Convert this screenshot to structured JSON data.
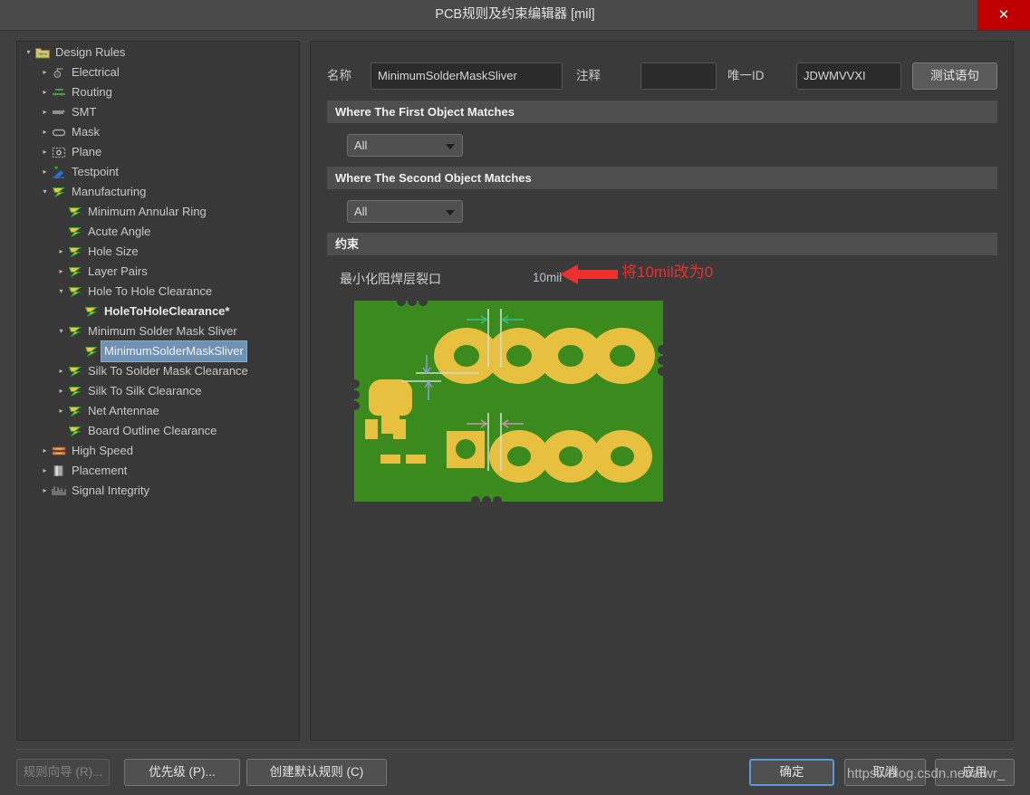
{
  "window": {
    "title": "PCB规则及约束编辑器 [mil]",
    "close_label": "✕",
    "close_icon": "close-icon"
  },
  "tree": {
    "items": [
      {
        "label": "Design Rules",
        "depth": 0,
        "twisty": "down",
        "icon": "design-rules-folder-icon",
        "selected": false,
        "bold": false
      },
      {
        "label": "Electrical",
        "depth": 1,
        "twisty": "right",
        "icon": "electrical-icon",
        "selected": false,
        "bold": false
      },
      {
        "label": "Routing",
        "depth": 1,
        "twisty": "right",
        "icon": "routing-icon",
        "selected": false,
        "bold": false
      },
      {
        "label": "SMT",
        "depth": 1,
        "twisty": "right",
        "icon": "smt-icon",
        "selected": false,
        "bold": false
      },
      {
        "label": "Mask",
        "depth": 1,
        "twisty": "right",
        "icon": "mask-icon",
        "selected": false,
        "bold": false
      },
      {
        "label": "Plane",
        "depth": 1,
        "twisty": "right",
        "icon": "plane-icon",
        "selected": false,
        "bold": false
      },
      {
        "label": "Testpoint",
        "depth": 1,
        "twisty": "right",
        "icon": "testpoint-icon",
        "selected": false,
        "bold": false
      },
      {
        "label": "Manufacturing",
        "depth": 1,
        "twisty": "down",
        "icon": "manufacturing-icon",
        "selected": false,
        "bold": false
      },
      {
        "label": "Minimum Annular Ring",
        "depth": 2,
        "twisty": "none",
        "icon": "rule-icon",
        "selected": false,
        "bold": false
      },
      {
        "label": "Acute Angle",
        "depth": 2,
        "twisty": "none",
        "icon": "rule-icon",
        "selected": false,
        "bold": false
      },
      {
        "label": "Hole Size",
        "depth": 2,
        "twisty": "right",
        "icon": "rule-icon",
        "selected": false,
        "bold": false
      },
      {
        "label": "Layer Pairs",
        "depth": 2,
        "twisty": "right",
        "icon": "rule-icon",
        "selected": false,
        "bold": false
      },
      {
        "label": "Hole To Hole Clearance",
        "depth": 2,
        "twisty": "down",
        "icon": "rule-icon",
        "selected": false,
        "bold": false
      },
      {
        "label": "HoleToHoleClearance*",
        "depth": 3,
        "twisty": "none",
        "icon": "rule-icon",
        "selected": false,
        "bold": true
      },
      {
        "label": "Minimum Solder Mask Sliver",
        "depth": 2,
        "twisty": "down",
        "icon": "rule-icon",
        "selected": false,
        "bold": false
      },
      {
        "label": "MinimumSolderMaskSliver",
        "depth": 3,
        "twisty": "none",
        "icon": "rule-icon",
        "selected": true,
        "bold": false
      },
      {
        "label": "Silk To Solder Mask Clearance",
        "depth": 2,
        "twisty": "right",
        "icon": "rule-icon",
        "selected": false,
        "bold": false
      },
      {
        "label": "Silk To Silk Clearance",
        "depth": 2,
        "twisty": "right",
        "icon": "rule-icon",
        "selected": false,
        "bold": false
      },
      {
        "label": "Net Antennae",
        "depth": 2,
        "twisty": "right",
        "icon": "rule-icon",
        "selected": false,
        "bold": false
      },
      {
        "label": "Board Outline Clearance",
        "depth": 2,
        "twisty": "none",
        "icon": "rule-icon",
        "selected": false,
        "bold": false
      },
      {
        "label": "High Speed",
        "depth": 1,
        "twisty": "right",
        "icon": "high-speed-icon",
        "selected": false,
        "bold": false
      },
      {
        "label": "Placement",
        "depth": 1,
        "twisty": "right",
        "icon": "placement-icon",
        "selected": false,
        "bold": false
      },
      {
        "label": "Signal Integrity",
        "depth": 1,
        "twisty": "right",
        "icon": "signal-integrity-icon",
        "selected": false,
        "bold": false
      }
    ]
  },
  "form": {
    "name_label": "名称",
    "name_value": "MinimumSolderMaskSliver",
    "comment_label": "注释",
    "comment_value": "",
    "unique_id_label": "唯一ID",
    "unique_id_value": "JDWMVVXI",
    "test_query_label": "测试语句"
  },
  "sections": {
    "first_object": "Where The First Object Matches",
    "second_object": "Where The Second Object Matches",
    "constraints": "约束"
  },
  "filters": {
    "first_scope": "All",
    "second_scope": "All"
  },
  "constraint": {
    "label": "最小化阻焊层裂口",
    "value": "10mil"
  },
  "annotation": {
    "text": "将10mil改为0",
    "color": "#ef2e2e",
    "arrow_icon": "left-arrow-icon"
  },
  "pcb_preview": {
    "name": "solder-mask-sliver-preview",
    "board_color": "#3a8a1e",
    "pad_color": "#e8c040"
  },
  "footer": {
    "rule_wizard": "规则向导 (R)...",
    "priority": "优先级 (P)...",
    "create_default": "创建默认规则 (C)",
    "ok": "确定",
    "cancel": "取消",
    "apply": "应用"
  },
  "watermark": {
    "text": "https://blog.csdn.net/aiwr_"
  }
}
